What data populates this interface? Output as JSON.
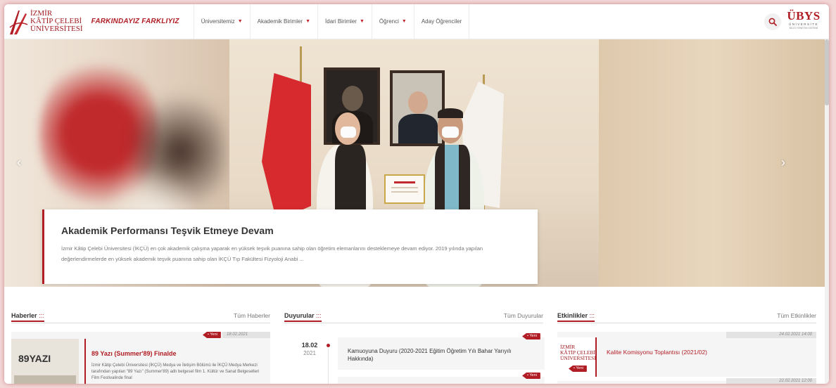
{
  "header": {
    "logo_lines": [
      "İZMİR",
      "KÂTİP ÇELEBİ",
      "ÜNİVERSİTESİ"
    ],
    "slogan": "FARKINDAYIZ FARKLIYIZ",
    "nav": [
      {
        "label": "Üniversitemiz",
        "dropdown": true
      },
      {
        "label": "Akademik Birimler",
        "dropdown": true
      },
      {
        "label": "İdari Birimler",
        "dropdown": true
      },
      {
        "label": "Öğrenci",
        "dropdown": true
      },
      {
        "label": "Aday Öğrenciler",
        "dropdown": false
      }
    ],
    "ubys": {
      "title": "ÜBYS",
      "sub1": "ÜNİVERSİTE",
      "sub2": "BİLGİ YÖNETİM SİSTEMİ"
    },
    "search_icon": "search-icon"
  },
  "hero": {
    "title": "Akademik Performansı Teşvik Etmeye Devam",
    "text": "İzmir Kâtip Çelebi Üniversitesi (İKÇÜ) en çok akademik çalışma yaparak en yüksek teşvik puanına sahip olan öğretim elemanlarını desteklemeye devam ediyor. 2019 yılında yapılan değerlendirmelerde en yüksek akademik teşvik puanına sahip olan İKÇÜ Tıp Fakültesi Fizyoloji Anabi ...",
    "prev_arrow": "‹",
    "next_arrow": "›"
  },
  "news": {
    "title": "Haberler",
    "dots": ":::",
    "all_link": "Tüm Haberler",
    "badge": "Yeni",
    "date": "18.02.2021",
    "item_title": "89 Yazı (Summer'89) Finalde",
    "item_text": "İzmir Kâtip Çelebi Üniversitesi (İKÇÜ) Medya ve İletişim Bölümü ile İKÇÜ Medya Merkezi tarafından yapılan \"89 Yazı\" (Summer'89) adlı belgesel film 1. Kültür ve Sanat Belgeselleri Film Festivalinde final",
    "thumb_text": "89YAZI"
  },
  "announcements": {
    "title": "Duyurular",
    "dots": ":::",
    "all_link": "Tüm Duyurular",
    "badge": "Yeni",
    "day": "18.02",
    "year": "2021",
    "item_title": "Kamuoyuna Duyuru (2020-2021 Eğitim Öğretim Yılı Bahar Yarıyılı Hakkında)"
  },
  "events": {
    "title": "Etkinlikler",
    "dots": ":::",
    "all_link": "Tüm Etkinlikler",
    "badge": "Yeni",
    "datetime": "24.02.2021 14:00",
    "item_title": "Kalite Komisyonu Toplantısı (2021/02)",
    "next_datetime": "22.02.2021 12:00"
  },
  "colors": {
    "accent": "#b01d24",
    "background": "#ffffff"
  }
}
